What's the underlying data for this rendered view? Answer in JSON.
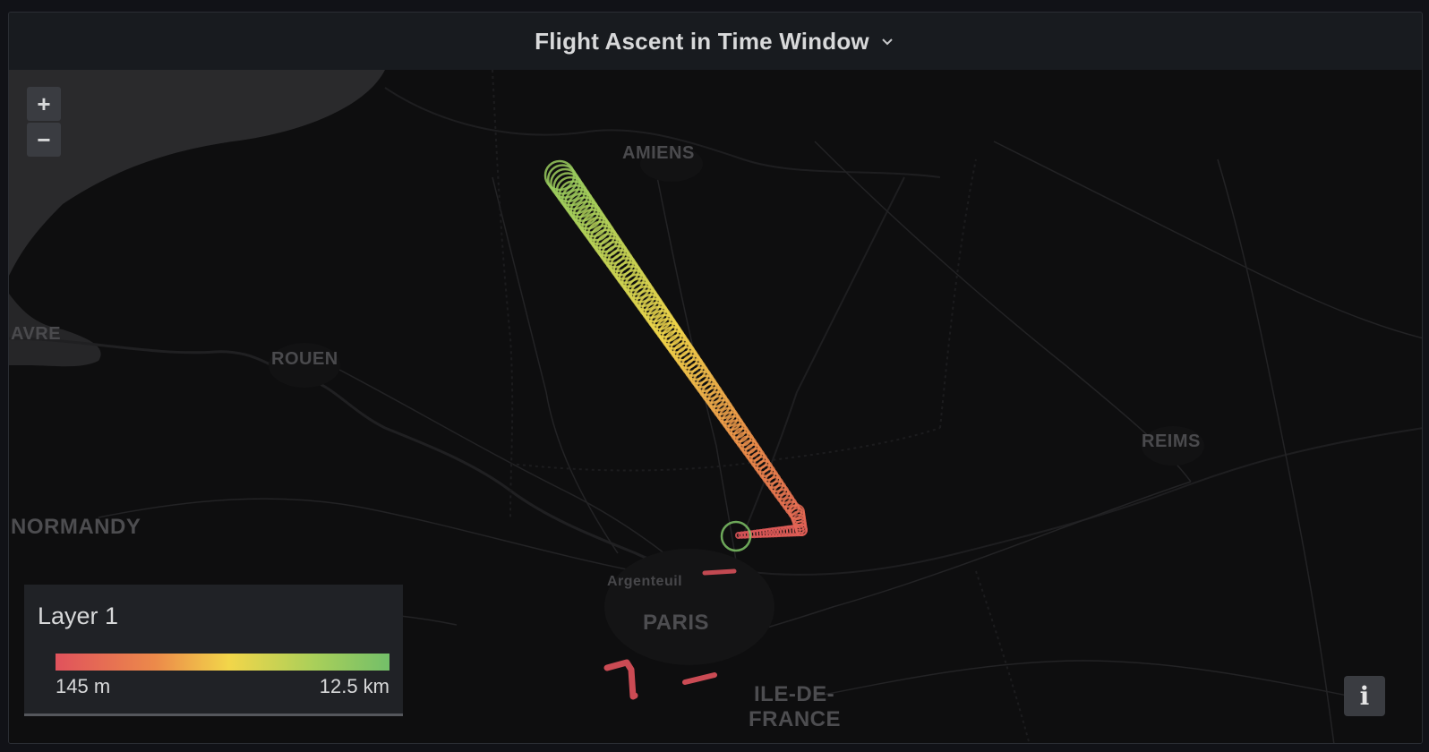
{
  "panel": {
    "title": "Flight Ascent in Time Window"
  },
  "map": {
    "zoom_in": "+",
    "zoom_out": "−",
    "places": {
      "amiens": "AMIENS",
      "havre": "AVRE",
      "rouen": "ROUEN",
      "normandy": "NORMANDY",
      "reims": "REIMS",
      "argenteuil": "Argenteuil",
      "paris": "PARIS",
      "ile_de_france_1": "ILE-DE-",
      "ile_de_france_2": "FRANCE"
    }
  },
  "legend": {
    "title": "Layer 1",
    "min_label": "145 m",
    "max_label": "12.5 km",
    "gradient_colors": [
      "#e0525c",
      "#ec8a4a",
      "#f2d64a",
      "#a8cf5a",
      "#73bf69"
    ]
  },
  "info_button": {
    "label": "i"
  }
}
